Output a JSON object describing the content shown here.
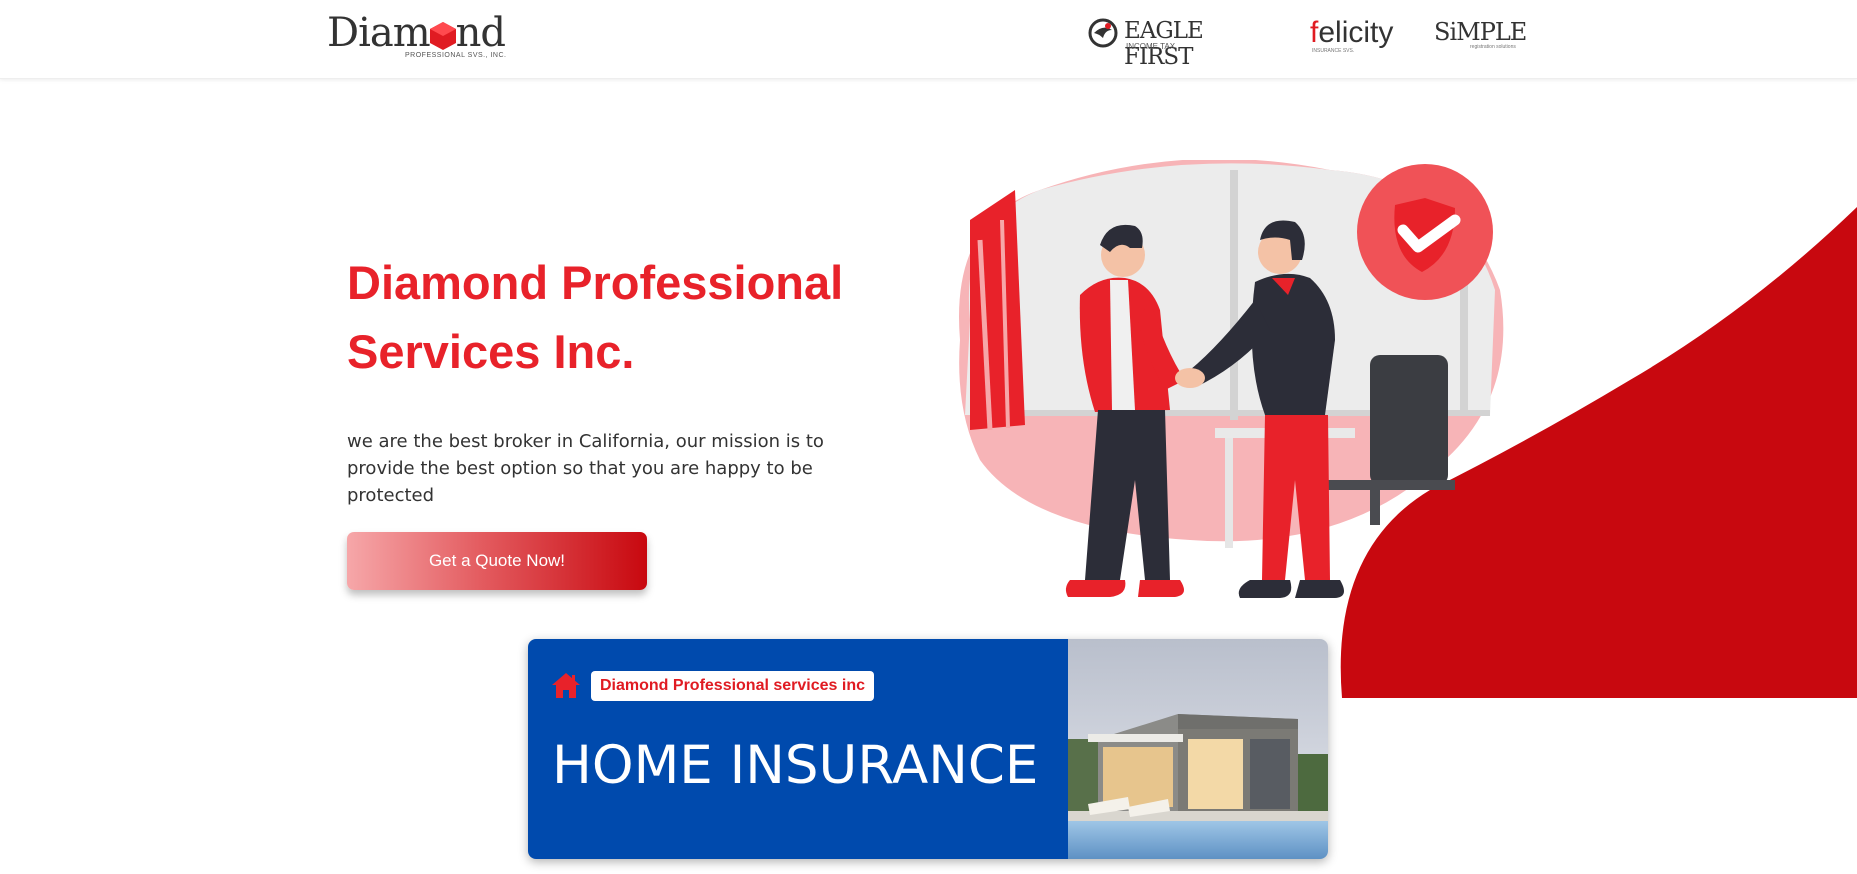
{
  "header": {
    "logo": {
      "word": "Diamond",
      "subtitle": "PROFESSIONAL SVS., INC."
    },
    "partners": [
      {
        "name": "EAGLE FIRST",
        "tagline": "INCOME TAX"
      },
      {
        "name_prefix": "f",
        "name_rest": "elicity",
        "tagline": "INSURANCE SVS."
      },
      {
        "name": "SiMPLE",
        "tagline": "registration solutions"
      }
    ]
  },
  "hero": {
    "title": "Diamond Professional Services Inc.",
    "description": "we are the best broker in California, our mission is to provide the best option so that you are happy to be protected",
    "cta_label": "Get a Quote Now!"
  },
  "banner": {
    "brand": "Diamond Professional services inc",
    "title": "HOME INSURANCE"
  },
  "colors": {
    "brand_red": "#e8222a",
    "dark_red": "#c8080f",
    "banner_blue": "#004aad"
  },
  "icons": [
    "diamond-hexagon-icon",
    "eagle-icon",
    "home-icon",
    "shield-check-icon"
  ]
}
